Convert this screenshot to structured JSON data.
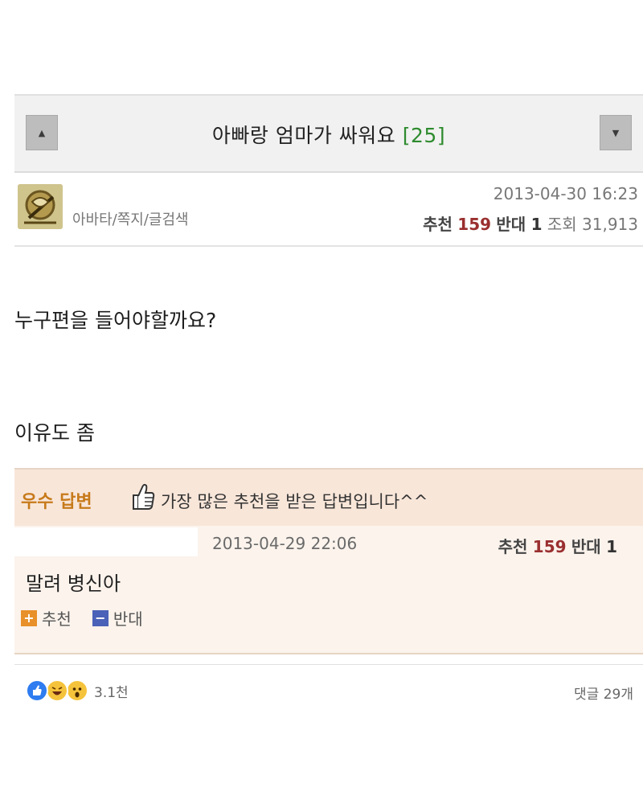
{
  "post": {
    "title": "아빠랑 엄마가 싸워요",
    "comment_badge": "[25]",
    "nav_prev_icon": "up-triangle-icon",
    "nav_next_icon": "down-triangle-icon",
    "author_links": "아바타/쪽지/글검색",
    "date": "2013-04-30 16:23",
    "stats": {
      "up_label": "추천",
      "up_value": "159",
      "down_label": "반대",
      "down_value": "1",
      "view_label": "조회",
      "view_value": "31,913"
    },
    "body_lines": [
      "누구편을 들어야할까요?",
      "이유도 좀"
    ]
  },
  "best_answer": {
    "badge": "우수 답변",
    "description": "가장 많은 추천을 받은 답변입니다^^",
    "date": "2013-04-29 22:06",
    "stats": {
      "up_label": "추천",
      "up_value": "159",
      "down_label": "반대",
      "down_value": "1"
    },
    "text": "말려 병신아",
    "vote_up_label": "추천",
    "vote_down_label": "반대",
    "vote_up_symbol": "+",
    "vote_down_symbol": "−"
  },
  "footer": {
    "reaction_count": "3.1천",
    "comment_count": "댓글 29개"
  },
  "colors": {
    "title_count": "#2e8b2e",
    "best_badge": "#c77a1a",
    "recommend": "#9a2f2f",
    "vote_up": "#e8902a",
    "vote_down": "#4a62b7",
    "best_bg": "#fbf3ec"
  }
}
